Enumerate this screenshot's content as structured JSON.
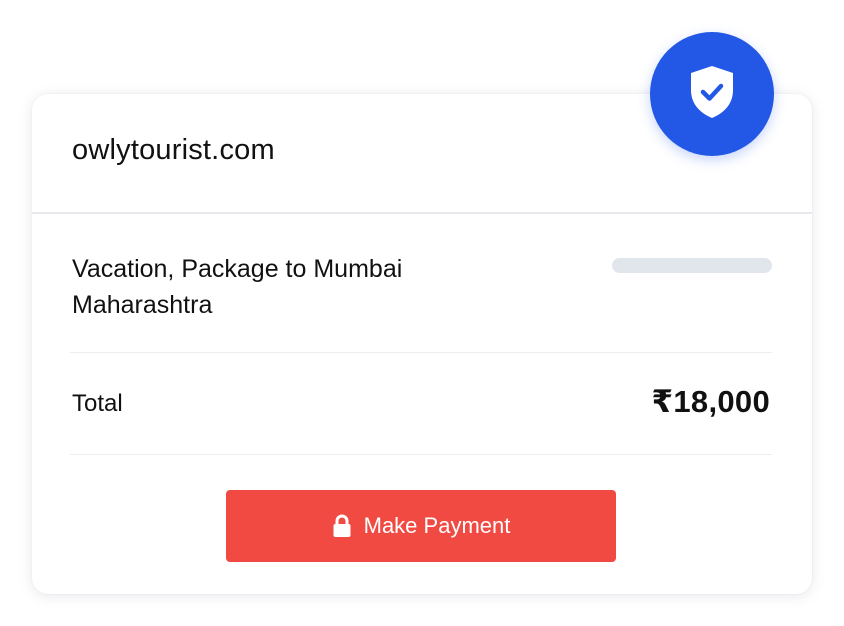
{
  "header": {
    "site_name": "owlytourist.com"
  },
  "order": {
    "item_description": "Vacation, Package to Mumbai Maharashtra",
    "total_label": "Total",
    "total_amount": "₹18,000"
  },
  "actions": {
    "pay_label": "Make Payment"
  },
  "icons": {
    "badge": "shield-check-icon",
    "button": "lock-icon"
  },
  "colors": {
    "accent_blue": "#2358e6",
    "pay_red": "#f04a43",
    "placeholder_gray": "#e1e6ec"
  }
}
